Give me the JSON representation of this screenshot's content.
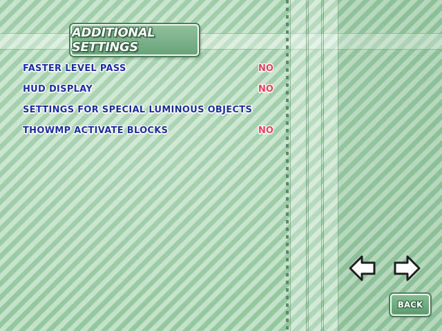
{
  "title": "ADDITIONAL SETTINGS",
  "options": [
    {
      "label": "FASTER LEVEL PASS",
      "value": "NO"
    },
    {
      "label": "HUD DISPLAY",
      "value": "NO"
    },
    {
      "label": "SETTINGS FOR SPECIAL LUMINOUS OBJECTS",
      "value": ""
    },
    {
      "label": "THOWMP ACTIVATE BLOCKS",
      "value": "NO"
    }
  ],
  "nav": {
    "prev_icon": "left-arrow-icon",
    "next_icon": "right-arrow-icon",
    "back_label": "BACK"
  },
  "colors": {
    "background": "#9fd1a8",
    "label_text": "#1a2f9a",
    "value_text": "#e0415a",
    "panel": "#6aa37a"
  }
}
